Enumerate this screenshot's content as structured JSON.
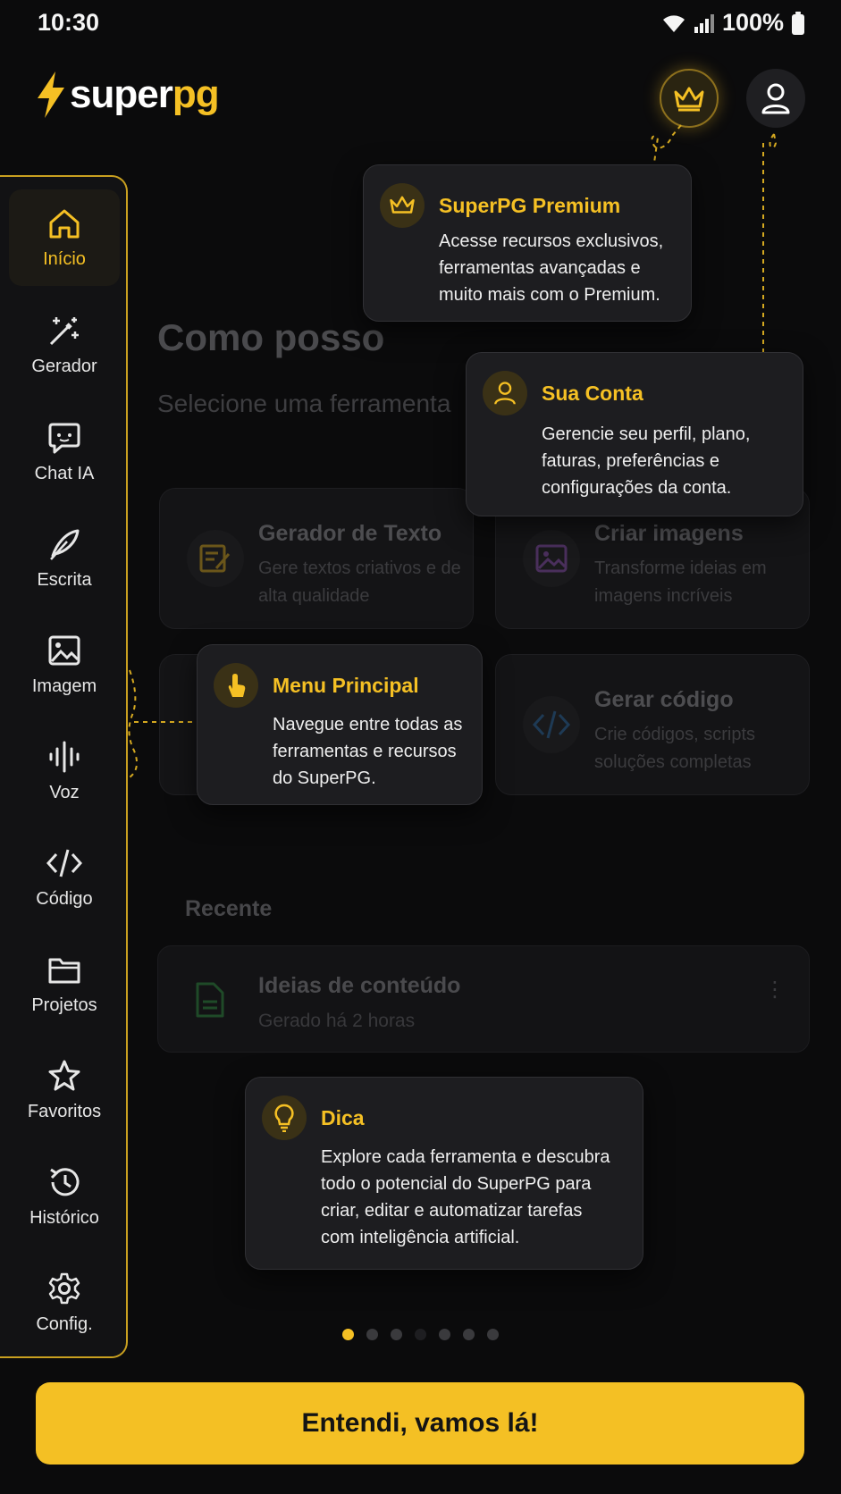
{
  "status": {
    "time": "10:30",
    "battery": "100%"
  },
  "logo": {
    "part1": "super",
    "part2": "pg"
  },
  "sidebar": {
    "items": [
      {
        "label": "Início",
        "icon": "home-icon",
        "active": true
      },
      {
        "label": "Gerador",
        "icon": "magic-wand-icon"
      },
      {
        "label": "Chat IA",
        "icon": "chat-bubble-icon"
      },
      {
        "label": "Escrita",
        "icon": "feather-pen-icon"
      },
      {
        "label": "Imagem",
        "icon": "image-icon"
      },
      {
        "label": "Voz",
        "icon": "voice-wave-icon"
      },
      {
        "label": "Código",
        "icon": "code-icon"
      },
      {
        "label": "Projetos",
        "icon": "folder-icon"
      },
      {
        "label": "Favoritos",
        "icon": "star-icon"
      },
      {
        "label": "Histórico",
        "icon": "history-icon"
      },
      {
        "label": "Config.",
        "icon": "gear-icon"
      }
    ]
  },
  "main": {
    "title": "Como posso",
    "subtitle": "Selecione uma ferramenta",
    "cards": [
      {
        "title": "Gerador de Texto",
        "desc": "Gere textos criativos e de alta qualidade"
      },
      {
        "title": "Criar imagens",
        "desc": "Transforme ideias em imagens incríveis"
      },
      {
        "title": "Gerar código",
        "desc": "Crie códigos, scripts soluções completas"
      }
    ],
    "recent_heading": "Recente",
    "recent": {
      "title": "Ideias de conteúdo",
      "time": "Gerado há 2 horas"
    }
  },
  "tooltips": {
    "premium": {
      "title": "SuperPG Premium",
      "lines": [
        "Acesse recursos exclusivos,",
        "ferramentas avançadas e",
        "muito mais com o Premium."
      ]
    },
    "account": {
      "title": "Sua Conta",
      "lines": [
        "Gerencie seu perfil, plano,",
        "faturas, preferências e",
        "configurações da conta."
      ]
    },
    "menu": {
      "title": "Menu Principal",
      "lines": [
        "Navegue entre todas as",
        "ferramentas e recursos",
        "do SuperPG."
      ]
    },
    "tip": {
      "title": "Dica",
      "lines": [
        "Explore cada ferramenta e descubra",
        "todo o potencial do SuperPG para",
        "criar, editar e automatizar tarefas",
        "com inteligência artificial."
      ]
    }
  },
  "pagination": {
    "total": 7,
    "current": 1
  },
  "cta": {
    "label": "Entendi, vamos lá!"
  },
  "colors": {
    "accent": "#f5c024",
    "background": "#0b0b0c",
    "tooltip": "#1d1d20"
  }
}
